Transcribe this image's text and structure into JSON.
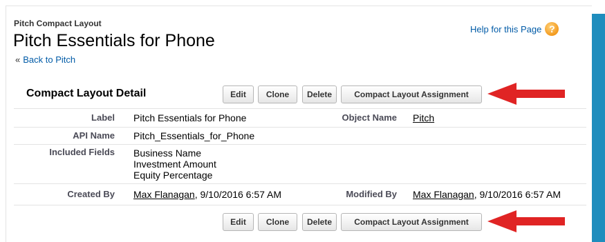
{
  "header": {
    "object_type": "Pitch Compact Layout",
    "title": "Pitch Essentials for Phone",
    "back_chevron": "«",
    "back_link": "Back to Pitch",
    "help_link": "Help for this Page",
    "help_icon": "?"
  },
  "detail": {
    "section_title": "Compact Layout Detail",
    "buttons": {
      "edit": "Edit",
      "clone": "Clone",
      "delete": "Delete",
      "assignment": "Compact Layout Assignment"
    },
    "fields": {
      "label_label": "Label",
      "label_value": "Pitch Essentials for Phone",
      "object_name_label": "Object Name",
      "object_name_value": "Pitch",
      "api_name_label": "API Name",
      "api_name_value": "Pitch_Essentials_for_Phone",
      "included_fields_label": "Included Fields",
      "included_fields": [
        "Business Name",
        "Investment Amount",
        "Equity Percentage"
      ],
      "created_by_label": "Created By",
      "created_by_user": "Max Flanagan",
      "created_by_date": ", 9/10/2016 6:57 AM",
      "modified_by_label": "Modified By",
      "modified_by_user": "Max Flanagan",
      "modified_by_date": ", 9/10/2016 6:57 AM"
    }
  },
  "colors": {
    "link": "#015ba7",
    "arrow": "#e02424",
    "side_bar": "#1f8dbd"
  }
}
